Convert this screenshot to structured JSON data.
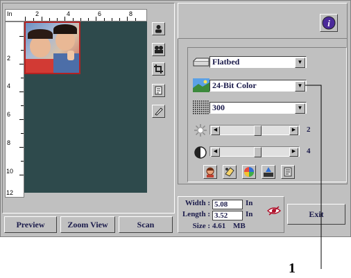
{
  "ruler": {
    "top_unit": "In",
    "top_labels": [
      "2",
      "4",
      "6",
      "8"
    ],
    "left_labels": [
      "2",
      "4",
      "6",
      "8",
      "10",
      "12"
    ]
  },
  "buttons": {
    "preview": "Preview",
    "zoom_view": "Zoom View",
    "scan": "Scan",
    "exit": "Exit"
  },
  "tools": [
    "portrait-icon",
    "auto-crop-icon",
    "crop-icon",
    "ruler-orient-icon",
    "pencil-icon"
  ],
  "controls": {
    "source": {
      "value": "Flatbed",
      "icon": "flatbed-icon"
    },
    "mode": {
      "value": "24-Bit Color",
      "icon": "color-landscape-icon"
    },
    "resolution": {
      "value": "300",
      "icon": "halftone-icon"
    },
    "brightness": {
      "value": "2",
      "icon": "sun-icon",
      "level": 0.55
    },
    "contrast": {
      "value": "4",
      "icon": "contrast-icon",
      "level": 0.55
    }
  },
  "image_tools": [
    "face-icon",
    "eraser-icon",
    "color-wheel-icon",
    "levels-icon",
    "filter-icon"
  ],
  "info": {
    "width_label": "Width :",
    "width_value": "5.08",
    "length_label": "Length :",
    "length_value": "3.52",
    "unit_1": "In",
    "unit_2": "In",
    "size_label": "Size :",
    "size_value": "4.61",
    "size_unit": "MB"
  },
  "callout": "1",
  "colors": {
    "scan_area": "#2e4a4c",
    "photo_border": "#b22222",
    "text": "#1a1a4a"
  }
}
